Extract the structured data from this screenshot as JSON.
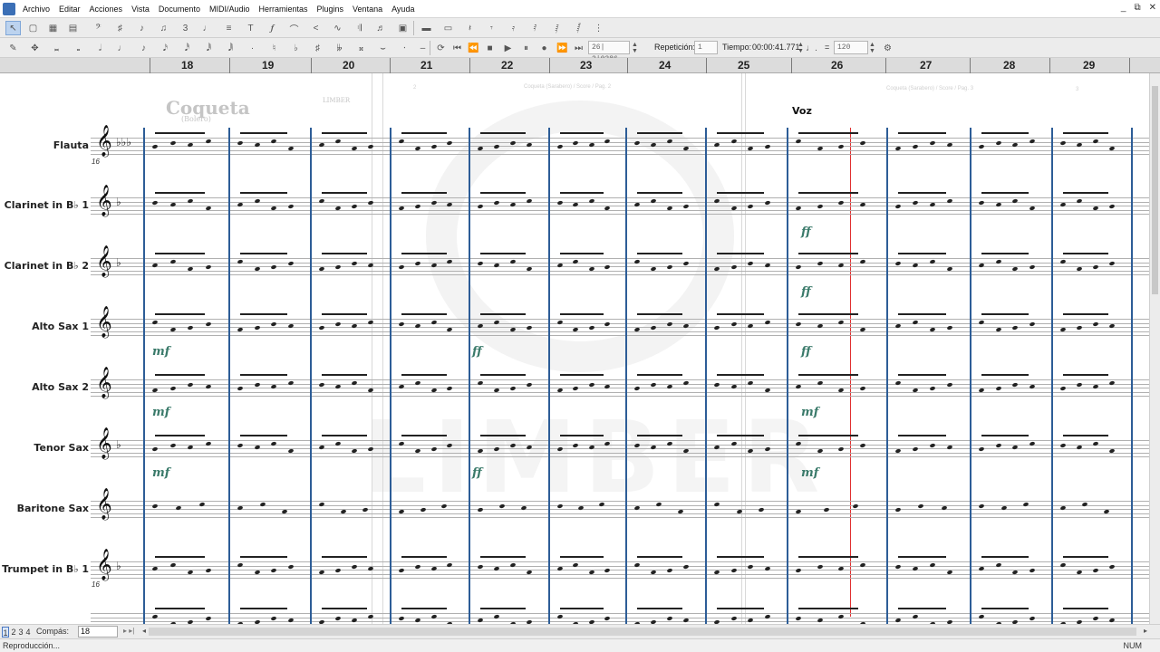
{
  "menu": {
    "items": [
      "Archivo",
      "Editar",
      "Acciones",
      "Vista",
      "Documento",
      "MIDI/Audio",
      "Herramientas",
      "Plugins",
      "Ventana",
      "Ayuda"
    ],
    "window_controls": [
      "_",
      "⧉",
      "✕"
    ]
  },
  "toolbar": {
    "position_value": "26| 2|0386",
    "repeat_label": "Repetición:",
    "repeat_value": "1",
    "tempo_label": "Tiempo:",
    "tempo_time": "00:00:41.771",
    "tempo_equals": "=",
    "tempo_bpm": "120"
  },
  "ruler": {
    "numbers": [
      "18",
      "19",
      "20",
      "21",
      "22",
      "23",
      "24",
      "25",
      "26",
      "27",
      "28",
      "29"
    ]
  },
  "score": {
    "ghost_title": "Coqueta",
    "ghost_subtitle": "(Bolero)",
    "ghost_logo": "LIMBER",
    "ghost_header_left": "Coqueta (Sarabero) / Score / Pag. 2",
    "ghost_header_right": "Coqueta (Sarabero) / Score / Pag. 3",
    "ghost_page_left": "2",
    "ghost_page_right": "3",
    "voice_label": "Voz",
    "measure_number_top": "16",
    "measure_number_bottom": "16",
    "instruments": [
      {
        "name": "Flauta",
        "clef": "𝄞",
        "key": "♭♭♭"
      },
      {
        "name": "Clarinet in B♭ 1",
        "clef": "𝄞",
        "key": "♭"
      },
      {
        "name": "Clarinet in B♭ 2",
        "clef": "𝄞",
        "key": "♭"
      },
      {
        "name": "Alto Sax 1",
        "clef": "𝄞",
        "key": ""
      },
      {
        "name": "Alto Sax 2",
        "clef": "𝄞",
        "key": ""
      },
      {
        "name": "Tenor Sax",
        "clef": "𝄞",
        "key": "♭"
      },
      {
        "name": "Baritone Sax",
        "clef": "𝄞",
        "key": ""
      },
      {
        "name": "Trumpet in B♭ 1",
        "clef": "𝄞",
        "key": "♭"
      }
    ],
    "dynamics": [
      "mf",
      "mf",
      "mf",
      "ff",
      "ff",
      "ff",
      "ff",
      "ff",
      "mf",
      "mf"
    ]
  },
  "bottom": {
    "pages": [
      "1",
      "2",
      "3",
      "4"
    ],
    "compas_label": "Compás:",
    "compas_value": "18",
    "status_text": "Reproducción...",
    "status_num": "NUM"
  },
  "colors": {
    "barline": "#2d5d97",
    "cursor": "#e03030",
    "dynamic": "#3a7a6a"
  }
}
